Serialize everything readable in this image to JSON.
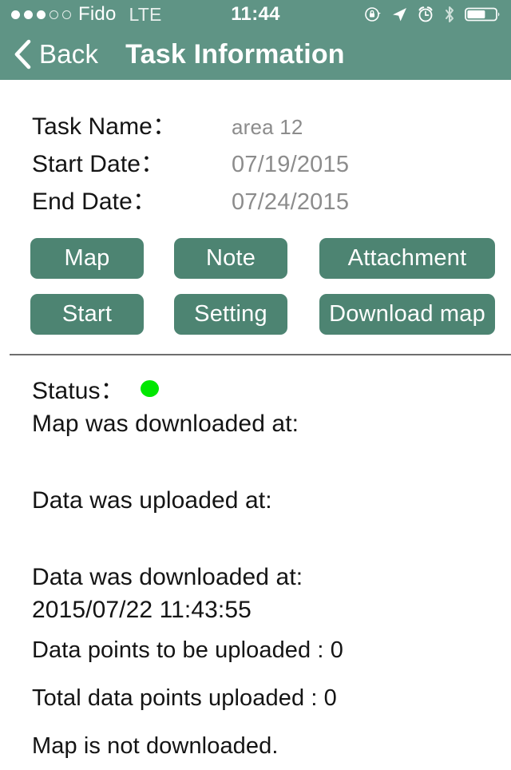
{
  "status_bar": {
    "signal_filled": 3,
    "signal_total": 5,
    "carrier": "Fido",
    "network": "LTE",
    "time": "11:44",
    "icons": [
      "rotation-lock-icon",
      "location-arrow-icon",
      "alarm-clock-icon",
      "bluetooth-icon",
      "battery-icon"
    ],
    "battery_percent": 62
  },
  "nav": {
    "back_label": "Back",
    "title": "Task Information",
    "bar_color": "#5f9485"
  },
  "info": {
    "rows": [
      {
        "label": "Task Name：",
        "value": "area 12"
      },
      {
        "label": "Start Date：",
        "value": "07/19/2015"
      },
      {
        "label": "End Date：",
        "value": "07/24/2015"
      }
    ]
  },
  "buttons": {
    "color": "#4d8472",
    "row1": [
      {
        "label": "Map"
      },
      {
        "label": "Note"
      },
      {
        "label": "Attachment"
      }
    ],
    "row2": [
      {
        "label": "Start"
      },
      {
        "label": "Setting"
      },
      {
        "label": "Download map"
      }
    ]
  },
  "status": {
    "label": "Status：",
    "indicator_color": "#00e700",
    "map_downloaded_label": "Map was downloaded at:",
    "map_downloaded_value": "",
    "data_uploaded_label": "Data was uploaded at:",
    "data_uploaded_value": "",
    "data_downloaded_label": "Data was downloaded at:",
    "data_downloaded_value": "2015/07/22 11:43:55",
    "points_to_upload": "Data points to be uploaded : 0",
    "total_uploaded": "Total data points uploaded : 0",
    "map_state": "Map is not downloaded."
  }
}
